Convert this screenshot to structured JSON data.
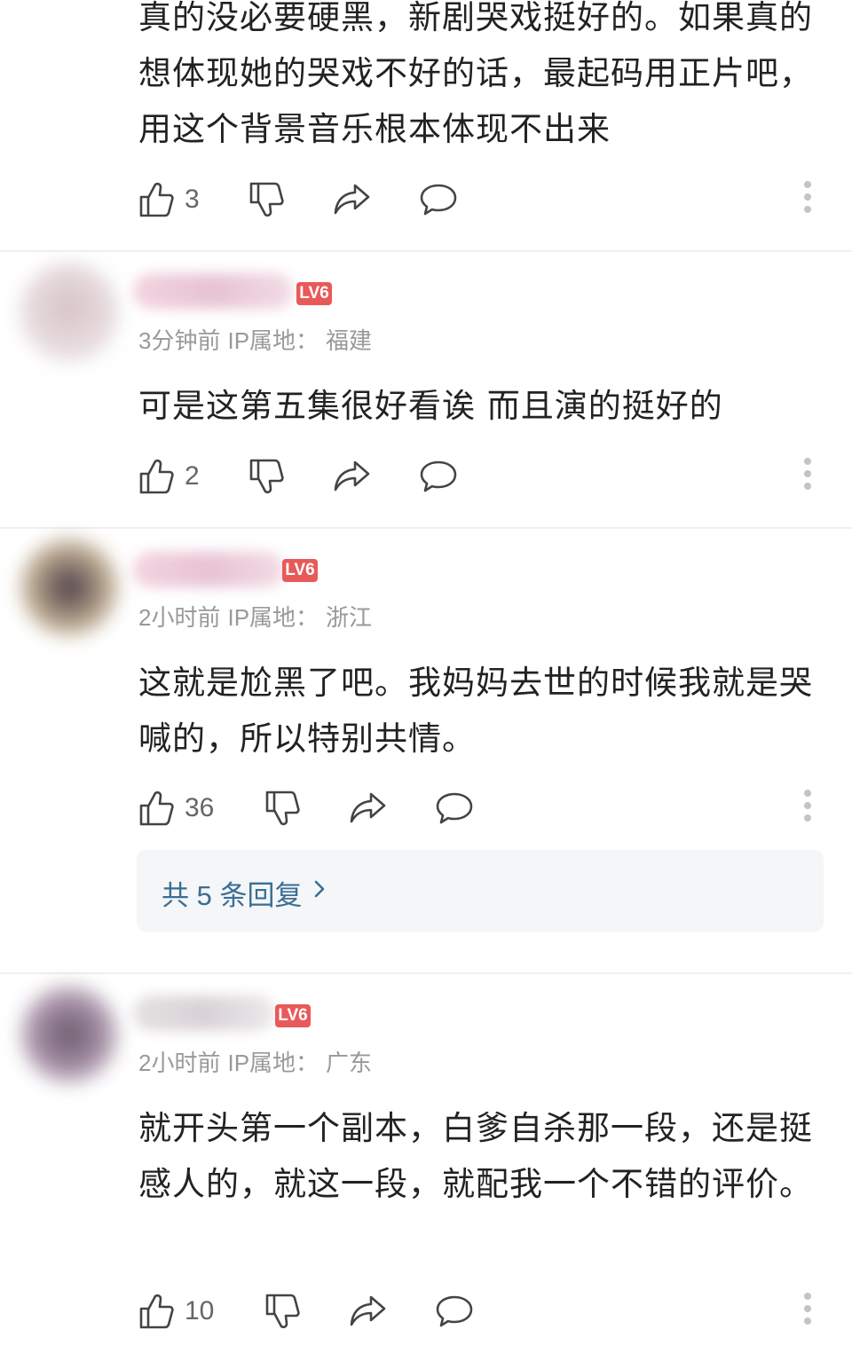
{
  "comments": [
    {
      "text": "真的没必要硬黑，新剧哭戏挺好的。如果真的想体现她的哭戏不好的话，最起码用正片吧，用这个背景音乐根本体现不出来",
      "likes": "3"
    },
    {
      "badge": "LV6",
      "time": "3分钟前",
      "ip_label": "IP属地：",
      "ip": "福建",
      "text": "可是这第五集很好看诶 而且演的挺好的",
      "likes": "2"
    },
    {
      "badge": "LV6",
      "time": "2小时前",
      "ip_label": "IP属地：",
      "ip": "浙江",
      "text": "这就是尬黑了吧。我妈妈去世的时候我就是哭喊的，所以特别共情。",
      "likes": "36",
      "replies_label": "共 5 条回复"
    },
    {
      "badge": "LV6",
      "time": "2小时前",
      "ip_label": "IP属地：",
      "ip": "广东",
      "text": "就开头第一个副本，白爹自杀那一段，还是挺感人的，就这一段，就配我一个不错的评价。",
      "likes": "10"
    }
  ],
  "icons": [
    "thumbs-up-icon",
    "thumbs-down-icon",
    "share-icon",
    "comment-bubble-icon",
    "more-vertical-icon",
    "chevron-right-icon"
  ],
  "colors": {
    "badge": "#e85a5a",
    "reply_link": "#3a6e93",
    "meta": "#999999"
  }
}
